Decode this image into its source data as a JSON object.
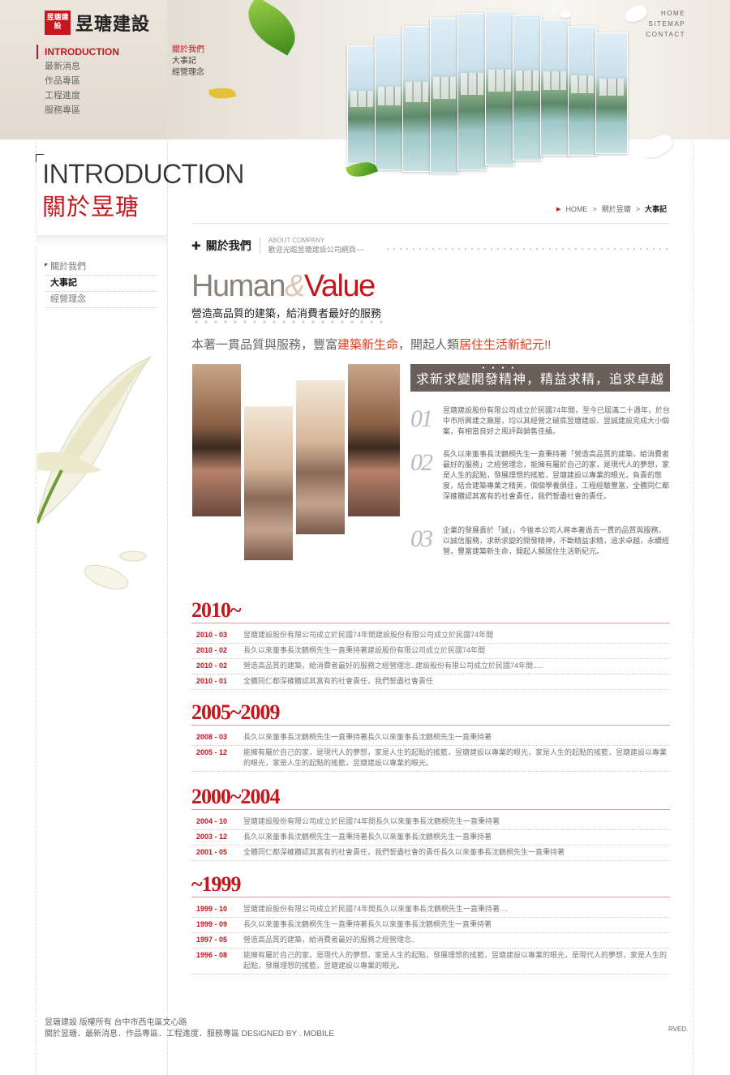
{
  "brand": {
    "seal": "昱瑭建設",
    "name": "昱瑭建設"
  },
  "topnav": [
    "INTRODUCTION",
    "最新消息",
    "作品專區",
    "工程進度",
    "服務專區"
  ],
  "subnav": [
    "關於我們",
    "大事記",
    "經營理念"
  ],
  "util_nav": [
    "HOME",
    "SITEMAP",
    "CONTACT"
  ],
  "page_heading": {
    "en": "INTRODUCTION",
    "zh": "關於昱瑭"
  },
  "sidemenu": [
    "關於我們",
    "大事記",
    "經營理念"
  ],
  "breadcrumb": [
    "HOME",
    "關於昱瑭",
    "大事記"
  ],
  "section": {
    "title": "關於我們",
    "sub": "ABOUT COMPANY",
    "desc": "歡迎光臨昱瑭建設公司網頁~~"
  },
  "headline": {
    "human": "Human",
    "amp": "&",
    "value": "Value",
    "tag": "營造高品質的建築，給消費者最好的服務"
  },
  "slogan": {
    "a": "本著一貫品質與服務，豐富",
    "b": "建築新生命",
    "c": "，開起人類",
    "d": "居住生活新紀元",
    "e": "!!"
  },
  "tagline": "求新求變開發精神，精益求精，追求卓越",
  "points": [
    {
      "num": "01",
      "text": "昱瑭建設股份有限公司成立於民國74年間，至今已屆滿二十週年，於台中市所興建之廠屋，均以其經營之破底昱瑭建設、昱誠建設完成大小個案，有相當良好之風評與銷售佳績。"
    },
    {
      "num": "02",
      "text": "長久以來董事長沈鶴桐先生一直秉持著「營造高品質的建築，給消費者最好的服務」之經營理念，能擁有屬於自己的家，是現代人的夢想，家是人生的起點，發展理想的搖籃，昱瑭建設以專業的眼光，負責的態度，結合建築專業之精英，個個學養俱佳，工程經驗豐富，全體同仁都深確體認其富有的社會責任，我們誓盡社會的責任。"
    },
    {
      "num": "03",
      "text": "企業的發展貴於「誠」，今後本公司人將本著過去一貫的品質與服務，以誠信服務，求新求變的開發精神，不斷精益求精，追求卓越，永續經營，豐富建築新生命，開起人類居住生活新紀元。"
    }
  ],
  "timeline": [
    {
      "year": "2010~",
      "rows": [
        {
          "date": "2010 - 03",
          "text": "昱瑭建設股份有限公司成立於民國74年間建設股份有限公司成立於民國74年間"
        },
        {
          "date": "2010 - 02",
          "text": "長久以來董事長沈鶴桐先生一直秉持著建設股份有限公司成立於民國74年間"
        },
        {
          "date": "2010 - 02",
          "text": "營造高品質的建築，給消費者最好的服務之經營理念..建設股份有限公司成立於民國74年間....."
        },
        {
          "date": "2010 - 01",
          "text": "全體同仁都深確體認其富有的社會責任，我們誓盡社會責任"
        }
      ]
    },
    {
      "year": "2005~2009",
      "rows": [
        {
          "date": "2008 - 03",
          "text": "長久以來董事長沈鶴桐先生一直秉持著長久以來董事長沈鶴桐先生一直秉持著"
        },
        {
          "date": "2005 - 12",
          "text": "能擁有屬於自己的家，是現代人的夢想，家是人生的起點的搖籃，昱瑭建設以專業的眼光，家是人生的起點的搖籃，昱瑭建設以專業的眼光，家是人生的起點的搖籃，昱瑭建設以專業的眼光。"
        }
      ]
    },
    {
      "year": "2000~2004",
      "rows": [
        {
          "date": "2004 - 10",
          "text": "昱瑭建設股份有限公司成立於民國74年間長久以來董事長沈鶴桐先生一直秉持著"
        },
        {
          "date": "2003 - 12",
          "text": "長久以來董事長沈鶴桐先生一直秉持著長久以來董事長沈鶴桐先生一直秉持著"
        },
        {
          "date": "2001 - 05",
          "text": "全體同仁都深確體認其富有的社會責任，我們誓盡社會的責任長久以來董事長沈鶴桐先生一直秉持著"
        }
      ]
    },
    {
      "year": "~1999",
      "rows": [
        {
          "date": "1999 - 10",
          "text": "昱瑭建設股份有限公司成立於民國74年間長久以來董事長沈鶴桐先生一直秉持著...."
        },
        {
          "date": "1999 - 09",
          "text": "長久以來董事長沈鶴桐先生一直秉持著長久以來董事長沈鶴桐先生一直秉持著"
        },
        {
          "date": "1997 - 05",
          "text": "營造高品質的建築，給消費者最好的服務之經營理念.."
        },
        {
          "date": "1996 - 08",
          "text": "能擁有屬於自己的家，是現代人的夢想，家是人生的起點，發展理想的搖籃，昱瑭建設以專業的眼光，是現代人的夢想，家是人生的起點，發展理想的搖籃，昱瑭建設以專業的眼光。"
        }
      ]
    }
  ],
  "footer": {
    "line1": "昱瑭建設 版權所有    台中市西屯區文心路",
    "line2": "關於昱瑭．最新消息．作品專區．工程進度．服務專區   DESIGNED BY . MOBILE",
    "right": "RVED."
  },
  "colors": {
    "accent": "#c4161c",
    "tagline_bg": "#6a5f58"
  }
}
